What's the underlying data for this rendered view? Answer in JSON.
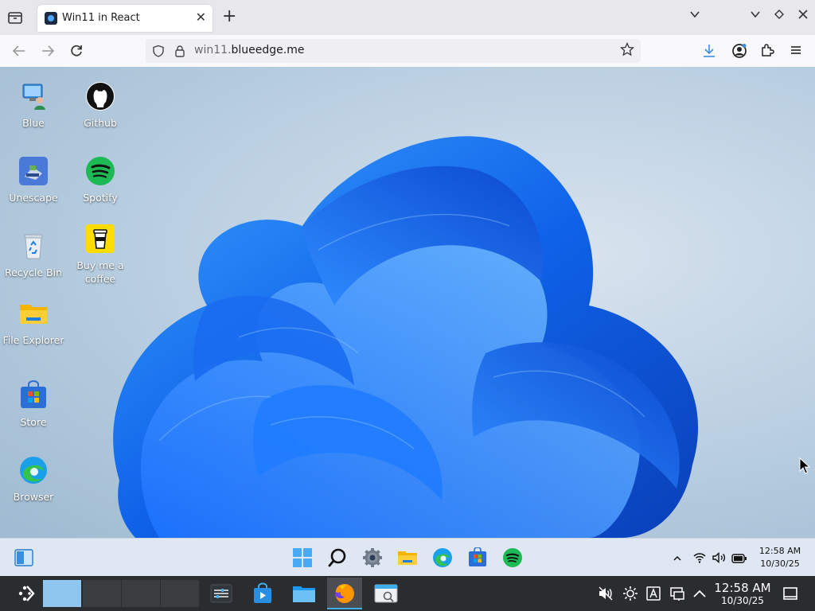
{
  "browser": {
    "tab": {
      "title": "Win11 in React",
      "close": "✕"
    },
    "new_tab": "+",
    "url": {
      "prefix": "win11.",
      "domain": "blueedge.me"
    }
  },
  "desktop": {
    "icons": [
      {
        "label": "Blue",
        "icon": "computer-user-icon"
      },
      {
        "label": "Github",
        "icon": "github-icon"
      },
      {
        "label": "Unescape",
        "icon": "unescape-game-icon"
      },
      {
        "label": "Spotify",
        "icon": "spotify-icon"
      },
      {
        "label": "Recycle Bin",
        "icon": "recycle-bin-icon"
      },
      {
        "label": "Buy me a coffee",
        "icon": "coffee-cup-icon"
      },
      {
        "label": "File Explorer",
        "icon": "folder-icon"
      },
      {
        "label": "Store",
        "icon": "store-icon"
      },
      {
        "label": "Browser",
        "icon": "edge-icon"
      }
    ]
  },
  "win11_taskbar": {
    "clock": {
      "time": "12:58 AM",
      "date": "10/30/25"
    },
    "apps": [
      "widgets-icon",
      "start-icon",
      "search-icon",
      "settings-icon",
      "file-explorer-icon",
      "edge-icon",
      "store-icon",
      "spotify-icon"
    ]
  },
  "kde_panel": {
    "clock": {
      "time": "12:58 AM",
      "date": "10/30/25"
    }
  },
  "colors": {
    "accent": "#0078d4",
    "spotify": "#1db954",
    "kde_accent": "#3daee9"
  }
}
